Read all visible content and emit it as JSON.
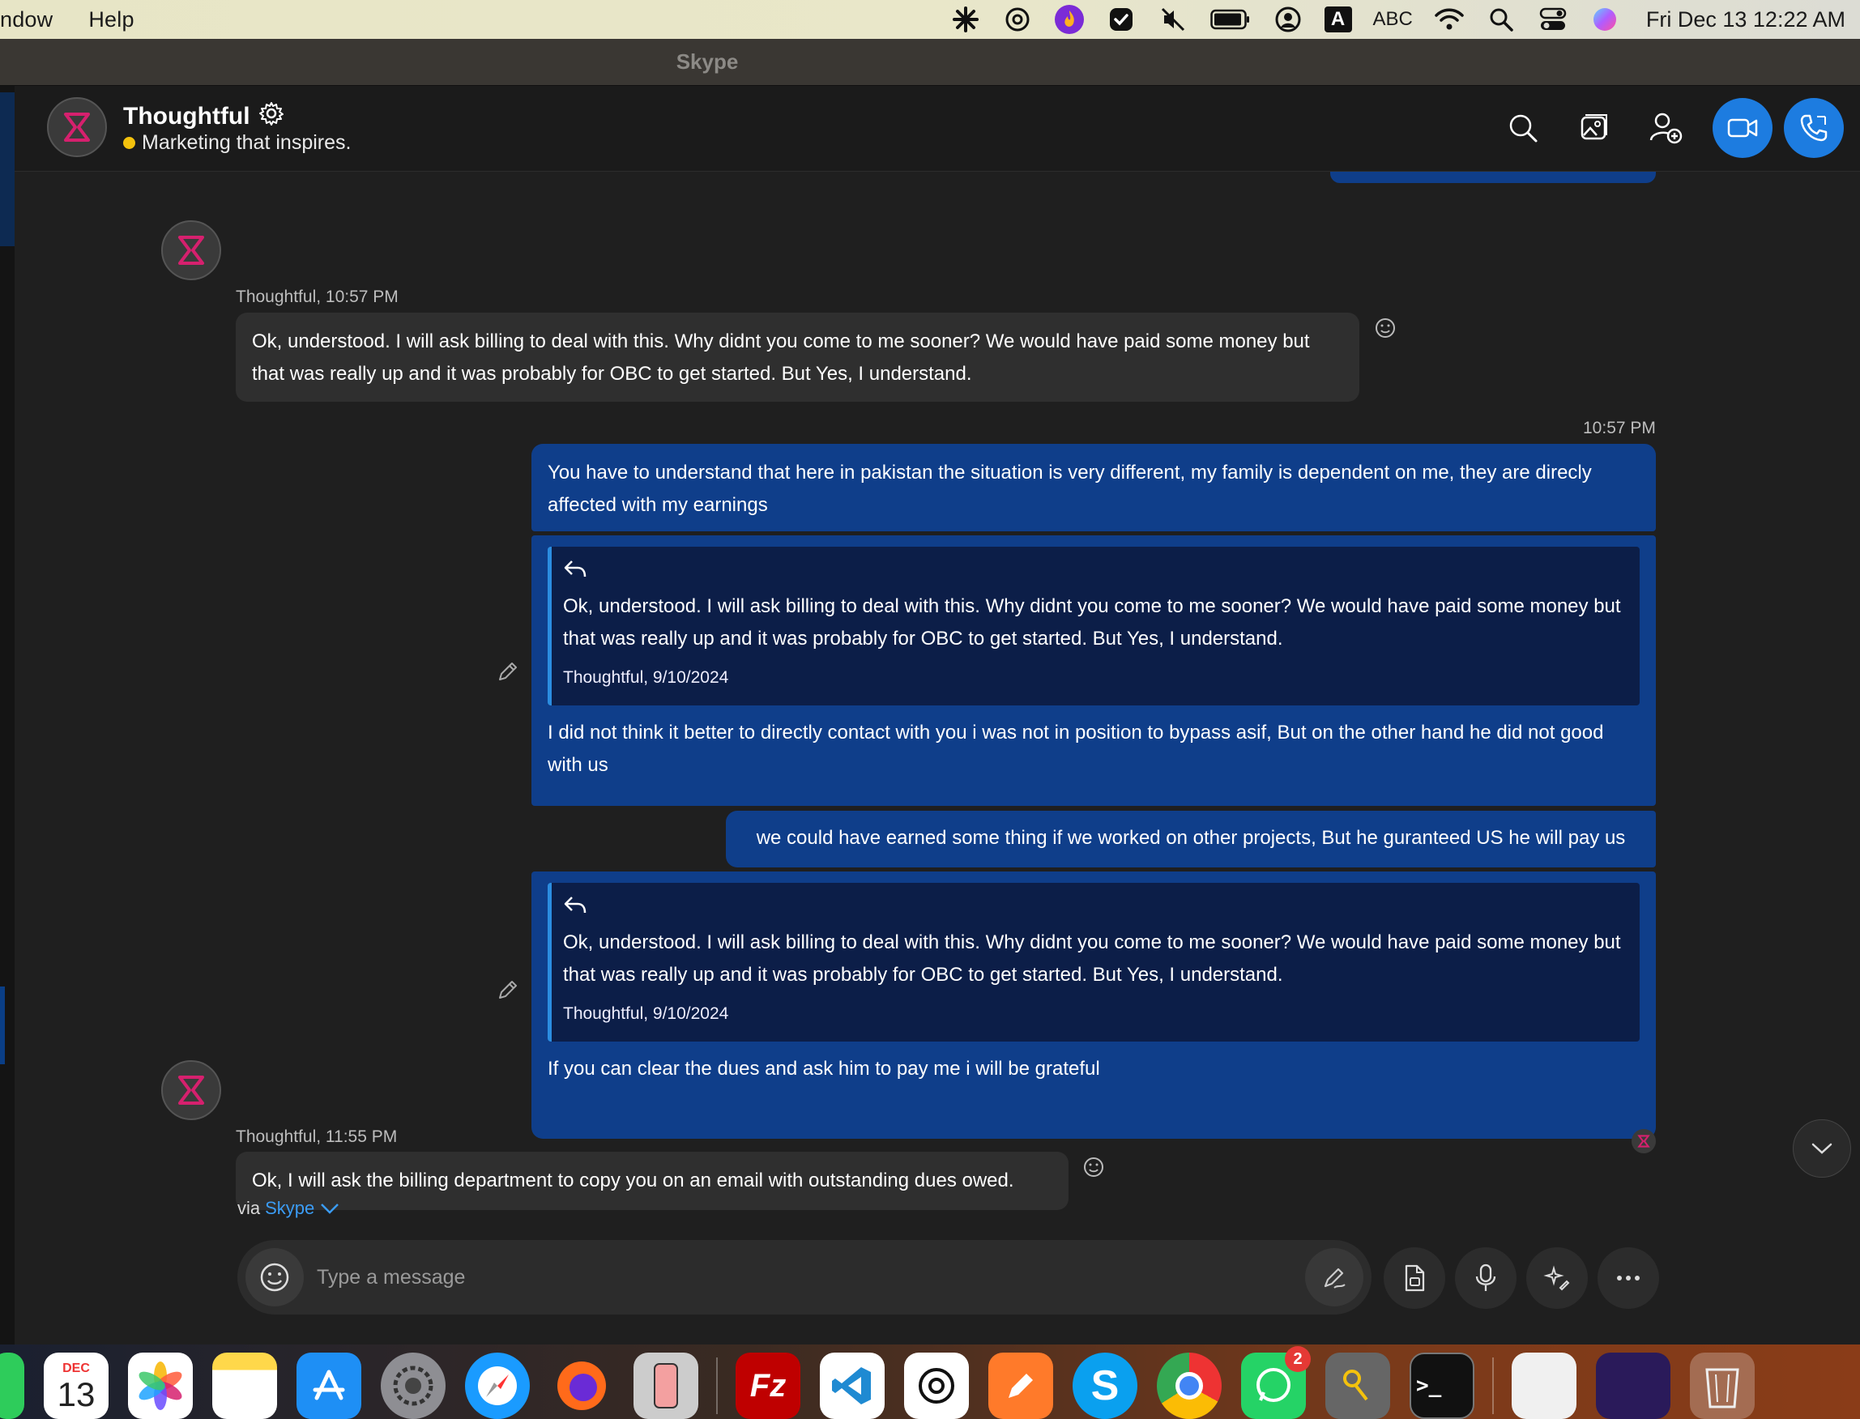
{
  "menubar": {
    "items": [
      "ndow",
      "Help"
    ],
    "tray": {
      "input_source_letter": "A",
      "keyboard_label": "ABC",
      "clock": "Fri Dec 13  12:22 AM"
    }
  },
  "window": {
    "title": "Skype"
  },
  "header": {
    "contact_name": "Thoughtful",
    "status_text": "Marketing that inspires.",
    "status_color": "#f4c20d"
  },
  "messages": {
    "m1": {
      "meta": "Thoughtful, 10:57 PM",
      "text": "Ok, understood. I will ask billing to deal with this. Why didnt you come to me sooner? We would have paid some money but that was really up and it was probably for OBC to get started. But Yes, I understand."
    },
    "m2": {
      "time": "10:57 PM",
      "text": "You have to understand that here in pakistan the situation is very different, my family is dependent on me, they are direcly affected with my earnings"
    },
    "m3": {
      "quote_text": "Ok, understood. I will ask billing to deal with this. Why didnt you come to me sooner? We would have paid some money but that was really up and it was probably for OBC to get started. But Yes, I understand.",
      "quote_meta": "Thoughtful, 9/10/2024",
      "text": "I did not think it better to directly contact with you i was not in position to bypass asif, But on the other hand he did not good with us"
    },
    "m4": {
      "text": "we could have earned some thing if we worked on other projects, But he guranteed US he will pay us"
    },
    "m5": {
      "quote_text": "Ok, understood. I will ask billing to deal with this. Why didnt you come to me sooner? We would have paid some money but that was really up and it was probably for OBC to get started. But Yes, I understand.",
      "quote_meta": "Thoughtful, 9/10/2024",
      "text": "If you can clear the dues and ask him to pay me i will be grateful"
    },
    "m6": {
      "meta": "Thoughtful, 11:55 PM",
      "text": "Ok, I will ask the billing department to copy you on an email with outstanding dues owed."
    }
  },
  "composer": {
    "via_label": "via",
    "via_service": "Skype",
    "placeholder": "Type a message"
  },
  "dock": {
    "calendar_month": "DEC",
    "calendar_day": "13",
    "whatsapp_badge": "2"
  },
  "colors": {
    "accent": "#1d7ce0",
    "outgoing_bubble": "#0f3e8a",
    "incoming_bubble": "#2f2f2f",
    "link": "#3b9cf5"
  }
}
